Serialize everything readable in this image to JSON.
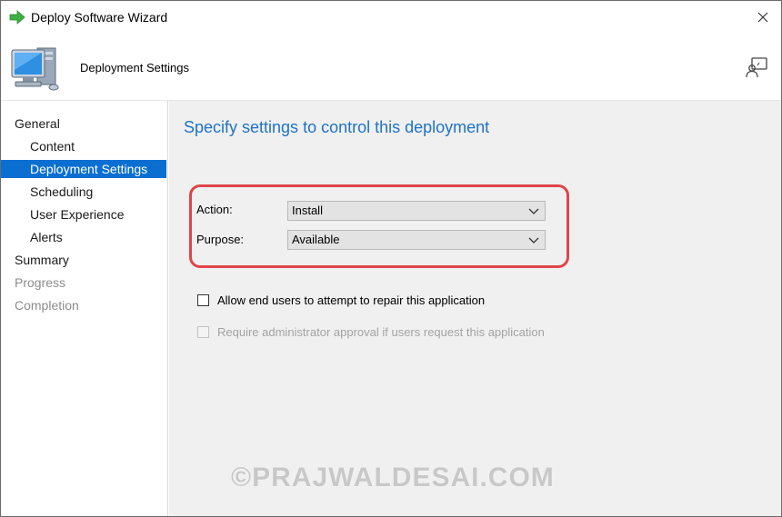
{
  "window": {
    "title": "Deploy Software Wizard",
    "icons": {
      "app": "green-arrow-icon",
      "close": "close-icon"
    }
  },
  "header": {
    "title": "Deployment Settings",
    "icons": {
      "main": "computer-icon",
      "feedback": "feedback-icon"
    }
  },
  "nav": {
    "items": [
      {
        "label": "General",
        "level": "top",
        "state": "normal"
      },
      {
        "label": "Content",
        "level": "sub",
        "state": "normal"
      },
      {
        "label": "Deployment Settings",
        "level": "sub",
        "state": "selected"
      },
      {
        "label": "Scheduling",
        "level": "sub",
        "state": "normal"
      },
      {
        "label": "User Experience",
        "level": "sub",
        "state": "normal"
      },
      {
        "label": "Alerts",
        "level": "sub",
        "state": "normal"
      },
      {
        "label": "Summary",
        "level": "top",
        "state": "normal"
      },
      {
        "label": "Progress",
        "level": "top",
        "state": "disabled"
      },
      {
        "label": "Completion",
        "level": "top",
        "state": "disabled"
      }
    ],
    "selected_color": "#0a6fd1"
  },
  "main": {
    "heading": "Specify settings to control this deployment",
    "action": {
      "label": "Action:",
      "value": "Install"
    },
    "purpose": {
      "label": "Purpose:",
      "value": "Available"
    },
    "allow_repair": {
      "label": "Allow end users to attempt to repair this application",
      "checked": false
    },
    "require_approval": {
      "label": "Require administrator approval if users request this application",
      "checked": false,
      "enabled": false
    },
    "highlight_color": "#e0454a",
    "heading_color": "#1e73c7"
  },
  "watermark": "©PRAJWALDESAI.COM"
}
